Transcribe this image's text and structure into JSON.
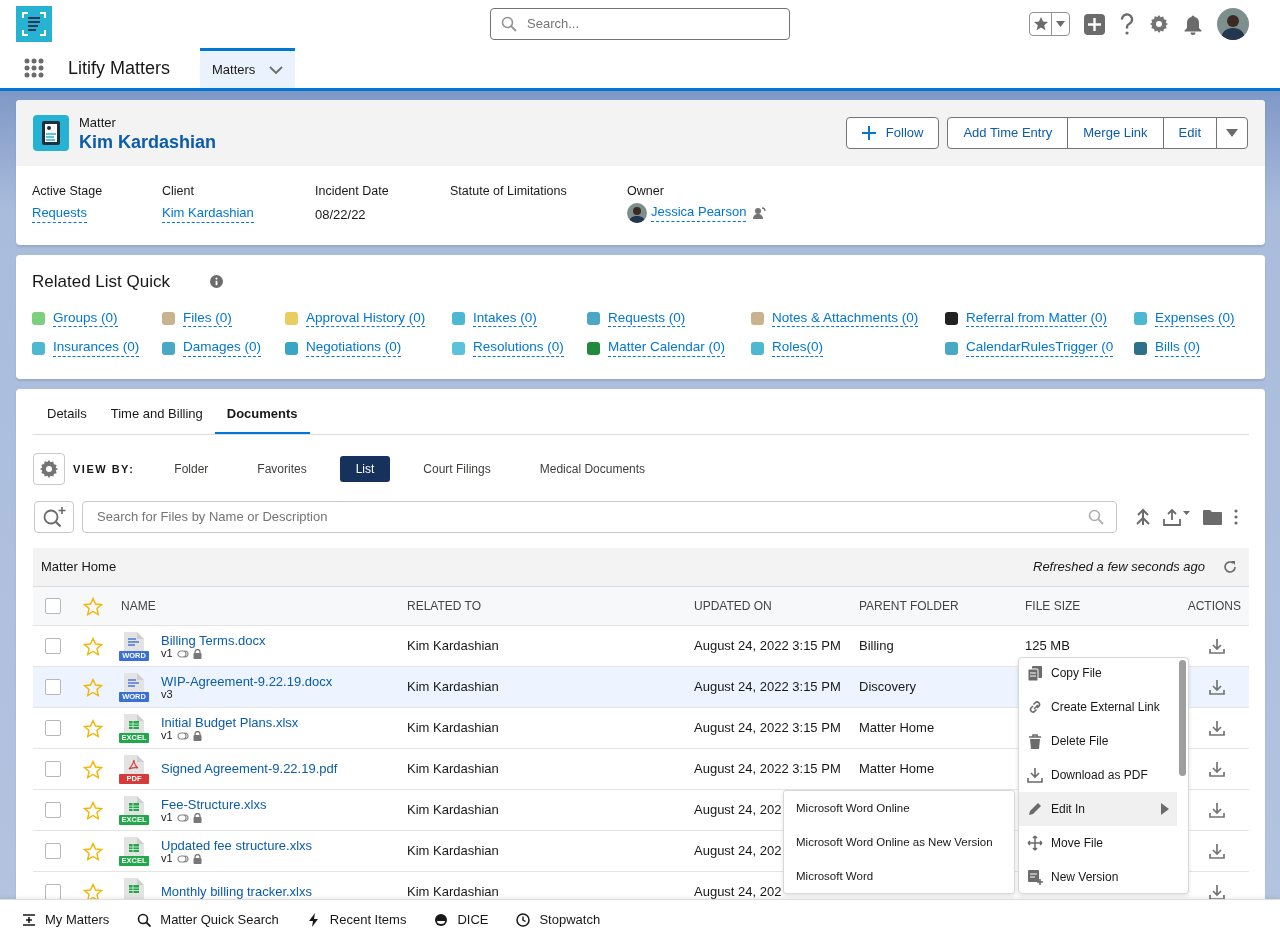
{
  "global_header": {
    "search_placeholder": "Search..."
  },
  "nav": {
    "app_name": "Litify Matters",
    "tabs": [
      {
        "label": "Matters",
        "selected": true
      }
    ]
  },
  "record": {
    "object_label": "Matter",
    "title": "Kim Kardashian",
    "actions": [
      {
        "label": "Follow",
        "kind": "follow"
      },
      {
        "label": "Add Time Entry",
        "kind": "group"
      },
      {
        "label": "Merge Link",
        "kind": "group"
      },
      {
        "label": "Edit",
        "kind": "group"
      }
    ],
    "fields": [
      {
        "label": "Active Stage",
        "value": "Requests",
        "kind": "link"
      },
      {
        "label": "Client",
        "value": "Kim Kardashian",
        "kind": "link"
      },
      {
        "label": "Incident Date",
        "value": "08/22/22",
        "kind": "text"
      },
      {
        "label": "Statute of Limitations"
      },
      {
        "label": "Owner",
        "value": "Jessica Pearson",
        "kind": "user"
      }
    ]
  },
  "related_list": {
    "title": "Related List Quick",
    "items": [
      {
        "label": "Groups (0)",
        "color": "#7ccf7c"
      },
      {
        "label": "Files (0)",
        "color": "#c9b38e"
      },
      {
        "label": "Approval History (0)",
        "color": "#e9cd5f"
      },
      {
        "label": "Intakes (0)",
        "color": "#4db8d2"
      },
      {
        "label": "Requests (0)",
        "color": "#4aa8c4"
      },
      {
        "label": "Notes & Attachments (0)",
        "color": "#c9b38e"
      },
      {
        "label": "Referral from Matter (0)",
        "color": "#222222"
      },
      {
        "label": "Expenses (0)",
        "color": "#4db8d2"
      },
      {
        "label": "Insurances (0)",
        "color": "#4db8d2"
      },
      {
        "label": "Damages (0)",
        "color": "#4aa8c4"
      },
      {
        "label": "Negotiations (0)",
        "color": "#3aa6c6"
      },
      {
        "label": "Resolutions (0)",
        "color": "#5cc2dc"
      },
      {
        "label": "Matter Calendar (0)",
        "color": "#1f8a3c"
      },
      {
        "label": "Roles(0)",
        "color": "#4db8d2"
      },
      {
        "label": "CalendarRulesTrigger (0",
        "color": "#4aa8c4"
      },
      {
        "label": "Bills (0)",
        "color": "#2e6f8c"
      }
    ]
  },
  "tabs": [
    {
      "label": "Details",
      "selected": false
    },
    {
      "label": "Time and Billing",
      "selected": false
    },
    {
      "label": "Documents",
      "selected": true
    }
  ],
  "view_by": {
    "label": "VIEW BY:",
    "options": [
      {
        "label": "Folder",
        "selected": false
      },
      {
        "label": "Favorites",
        "selected": false
      },
      {
        "label": "List",
        "selected": true
      },
      {
        "label": "Court Filings",
        "selected": false
      },
      {
        "label": "Medical Documents",
        "selected": false
      }
    ]
  },
  "file_search": {
    "placeholder": "Search for Files by Name or Description"
  },
  "table": {
    "folder": "Matter Home",
    "refreshed": "Refreshed a few seconds ago",
    "all_checked": false,
    "all_favorite": false,
    "columns": [
      "NAME",
      "RELATED TO",
      "UPDATED ON",
      "PARENT FOLDER",
      "FILE SIZE",
      "ACTIONS"
    ],
    "rows": [
      {
        "name": "Billing Terms.docx",
        "kind": "word",
        "type_label": "WORD",
        "version": "v1",
        "shared": true,
        "locked": true,
        "related": "Kim Kardashian",
        "updated": "August 24, 2022 3:15 PM",
        "folder": "Billing",
        "size": "125 MB",
        "checked": false,
        "favorite": false,
        "selected": false
      },
      {
        "name": "WIP-Agreement-9.22.19.docx",
        "kind": "word",
        "type_label": "WORD",
        "version": "v3",
        "shared": false,
        "locked": false,
        "related": "Kim Kardashian",
        "updated": "August 24, 2022 3:15 PM",
        "folder": "Discovery",
        "checked": false,
        "favorite": false,
        "selected": true
      },
      {
        "name": "Initial Budget Plans.xlsx",
        "kind": "excel",
        "type_label": "EXCEL",
        "version": "v1",
        "shared": true,
        "locked": true,
        "related": "Kim Kardashian",
        "updated": "August 24, 2022 3:15 PM",
        "folder": "Matter Home",
        "checked": false,
        "favorite": false,
        "selected": false
      },
      {
        "name": "Signed Agreement-9.22.19.pdf",
        "kind": "pdf",
        "type_label": "PDF",
        "related": "Kim Kardashian",
        "updated": "August 24, 2022 3:15 PM",
        "folder": "Matter Home",
        "checked": false,
        "favorite": false,
        "selected": false
      },
      {
        "name": "Fee-Structure.xlxs",
        "kind": "excel",
        "type_label": "EXCEL",
        "version": "v1",
        "shared": true,
        "locked": true,
        "related": "Kim Kardashian",
        "updated": "August 24, 202",
        "checked": false,
        "favorite": false,
        "selected": false
      },
      {
        "name": "Updated fee structure.xlxs",
        "kind": "excel",
        "type_label": "EXCEL",
        "version": "v1",
        "shared": true,
        "locked": true,
        "related": "Kim Kardashian",
        "updated": "August 24, 202",
        "checked": false,
        "favorite": false,
        "selected": false
      },
      {
        "name": "Monthly billing tracker.xlxs",
        "kind": "excel",
        "related": "Kim Kardashian",
        "updated": "August 24, 202",
        "checked": false,
        "favorite": false,
        "selected": false
      }
    ]
  },
  "context_menu": {
    "items": [
      {
        "label": "Copy File",
        "kind": "copy",
        "expanded": false
      },
      {
        "label": "Create External Link",
        "kind": "link",
        "expanded": false
      },
      {
        "label": "Delete File",
        "kind": "delete",
        "expanded": false
      },
      {
        "label": "Download as PDF",
        "kind": "download",
        "expanded": false
      },
      {
        "label": "Edit In",
        "kind": "edit",
        "expanded": true
      },
      {
        "label": "Move File",
        "kind": "move",
        "expanded": false
      },
      {
        "label": "New Version",
        "kind": "version",
        "expanded": false
      }
    ],
    "submenu": [
      "Microsoft Word Online",
      "Microsoft Word Online as New Version",
      "Microsoft Word"
    ]
  },
  "utility_bar": [
    {
      "label": "My Matters",
      "kind": "list"
    },
    {
      "label": "Matter Quick Search",
      "kind": "search"
    },
    {
      "label": "Recent Items",
      "kind": "bolt"
    },
    {
      "label": "DICE",
      "kind": "dice"
    },
    {
      "label": "Stopwatch",
      "kind": "clock"
    }
  ]
}
